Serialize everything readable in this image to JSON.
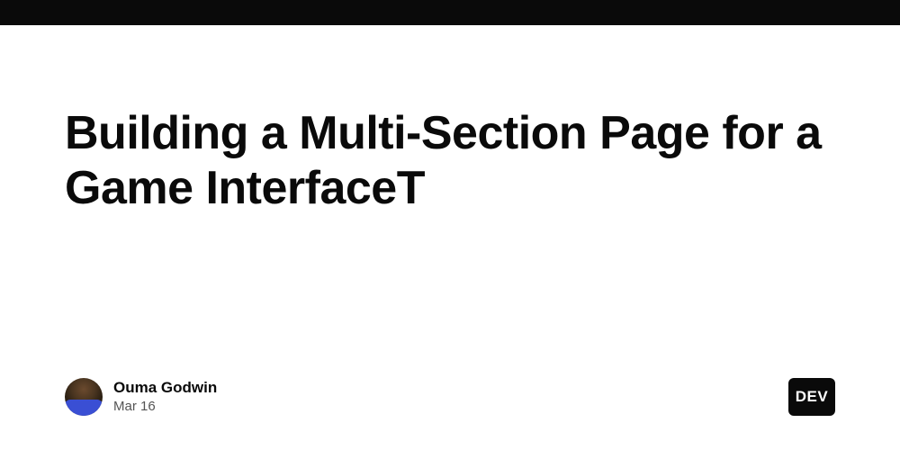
{
  "article": {
    "title": "Building a Multi-Section Page for a Game InterfaceT"
  },
  "author": {
    "name": "Ouma Godwin",
    "date": "Mar 16"
  },
  "badge": {
    "label": "DEV"
  }
}
